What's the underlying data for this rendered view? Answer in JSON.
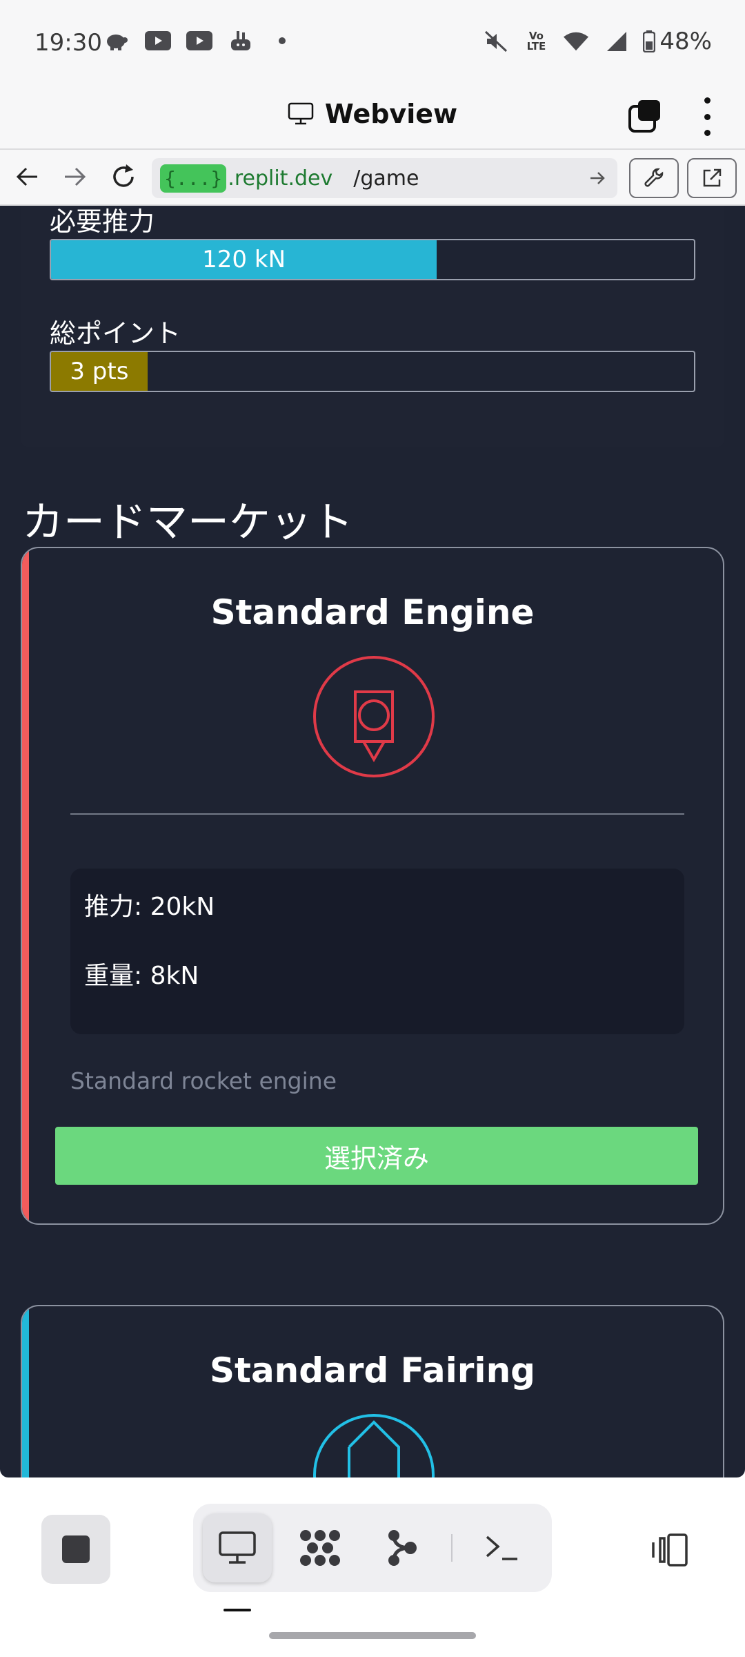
{
  "status_bar": {
    "time": "19:30",
    "battery": "48%",
    "lte_label": "Vo LTE",
    "icons": [
      "piggy-bank-icon",
      "youtube-icon",
      "youtube-icon",
      "app-icon",
      "dot-icon",
      "mute-icon",
      "lte-icon",
      "wifi-icon",
      "signal-icon",
      "battery-icon"
    ]
  },
  "webview": {
    "title": "Webview"
  },
  "url_bar": {
    "badge": "{...}",
    "domain": ".replit.dev",
    "path": "/game"
  },
  "game": {
    "thrust_label": "必要推力",
    "thrust_value": "120 kN",
    "thrust_fraction": 0.6,
    "points_label": "総ポイント",
    "points_value": "3 pts",
    "points_fraction": 0.15,
    "market_heading": "カードマーケット",
    "cards": [
      {
        "title": "Standard Engine",
        "thrust": "推力: 20kN",
        "weight": "重量: 8kN",
        "description": "Standard rocket engine",
        "button_label": "選択済み",
        "accent_color": "#f25c5c",
        "icon_color": "#e03a48"
      },
      {
        "title": "Standard Fairing",
        "accent_color": "#22b8d8",
        "icon_color": "#22c0e6"
      }
    ]
  },
  "colors": {
    "thrust_bar": "#27b5d4",
    "points_bar": "#8c7a00",
    "select_button": "#6bd87e",
    "background": "#1e2332"
  }
}
